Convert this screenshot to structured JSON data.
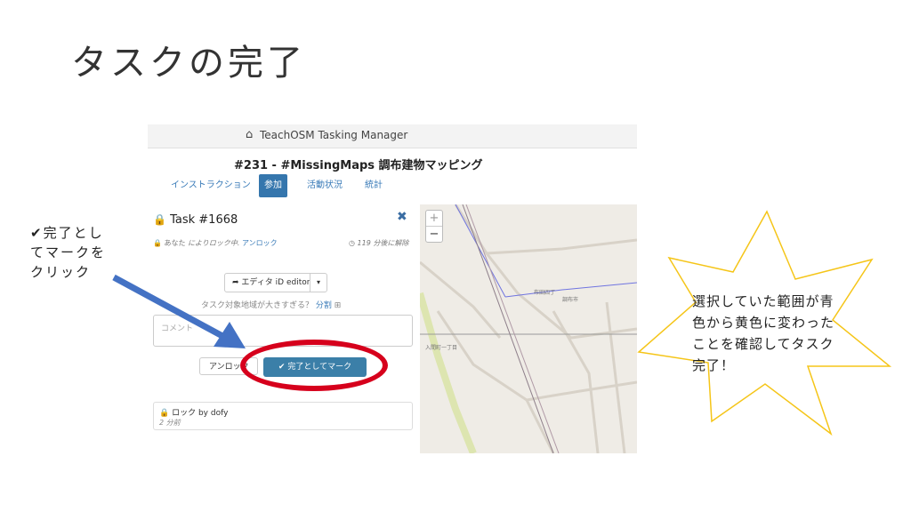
{
  "slide": {
    "title": "タスクの完了",
    "annotation_lines": [
      "✔完了とし",
      "てマークを",
      "クリック"
    ],
    "star_lines": [
      "選択していた範囲が青",
      "色から黄色に変わった",
      "ことを確認してタスク",
      "完了！"
    ],
    "colors": {
      "arrow": "#4472c4",
      "oval": "#d6001c",
      "star_fill": "#ffffff",
      "star_stroke": "#f5c518"
    }
  },
  "app": {
    "brand": "TeachOSM Tasking Manager",
    "home_icon": "home-icon",
    "project_title": "#231 - #MissingMaps 調布建物マッピング",
    "tabs": [
      {
        "label": "インストラクション",
        "active": false
      },
      {
        "label": "参加",
        "active": true
      },
      {
        "label": "活動状況",
        "active": false
      },
      {
        "label": "統計",
        "active": false
      }
    ]
  },
  "task": {
    "title": "Task #1668",
    "lock_prefix": "あなた",
    "lock_mid": "によりロック中.",
    "unlock_link": "アンロック",
    "timer": "119 分後に解除",
    "editor_label": "エディタ iD editor",
    "split_question": "タスク対象地域が大きすぎる？",
    "split_link": "分割",
    "comment_placeholder": "コメント",
    "unlock_button": "アンロック",
    "done_button": "完了としてマーク",
    "history_who": "ロック by dofy",
    "history_when": "2 分前"
  },
  "map": {
    "zoom_in": "+",
    "zoom_out": "−",
    "labels": [
      "布田四丁",
      "調布市",
      "入間町一丁目"
    ]
  }
}
